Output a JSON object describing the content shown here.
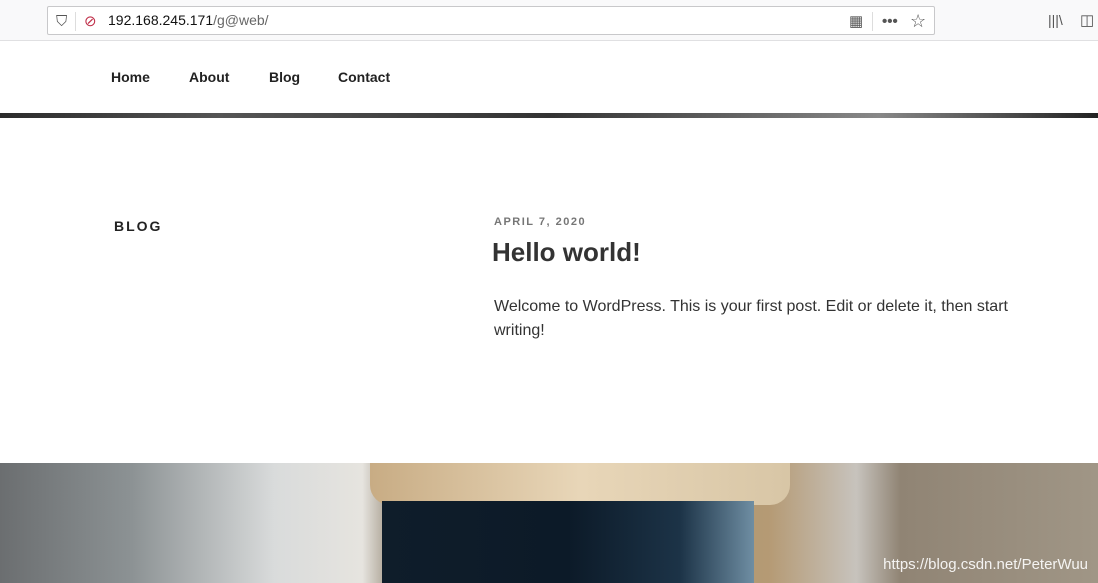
{
  "browser": {
    "url_host": "192.168.245.171",
    "url_path": "/g@web/",
    "icons": [
      "shield-icon",
      "insecure-lock-icon",
      "qr-code-icon",
      "more-icon",
      "star-icon",
      "library-icon",
      "sidebar-icon"
    ]
  },
  "nav": {
    "items": [
      "Home",
      "About",
      "Blog",
      "Contact"
    ]
  },
  "section_title": "BLOG",
  "post": {
    "date": "APRIL 7, 2020",
    "title": "Hello world!",
    "excerpt": "Welcome to WordPress. This is your first post. Edit or delete it, then start writing!"
  },
  "watermark": "https://blog.csdn.net/PeterWuu"
}
